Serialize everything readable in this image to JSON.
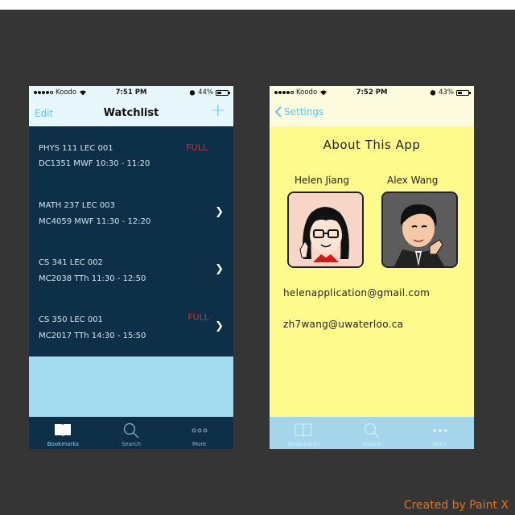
{
  "left_phone": {
    "status": {
      "carrier": "Koodo",
      "time": "7:51 PM",
      "battery": "44%",
      "battery_level": 0.44
    },
    "nav": {
      "edit_label": "Edit",
      "title": "Watchlist",
      "add_label": "+"
    },
    "courses": [
      {
        "line1": "PHYS 111    LEC 001",
        "line2": "DC1351    MWF 10:30 - 11:20",
        "status": "FULL",
        "chevron": false
      },
      {
        "line1": "MATH 237    LEC 003",
        "line2": "MC4059    MWF 11:30 - 12:20",
        "status": "",
        "chevron": true
      },
      {
        "line1": "CS 341    LEC 002",
        "line2": "MC2038    TTh 11:30 - 12:50",
        "status": "",
        "chevron": true
      },
      {
        "line1": "CS 350    LEC 001",
        "line2": "MC2017    TTh 14:30 - 15:50",
        "status": "FULL",
        "chevron": true
      }
    ],
    "tabs": [
      {
        "label": "Bookmarks",
        "icon": "book-icon"
      },
      {
        "label": "Search",
        "icon": "search-icon"
      },
      {
        "label": "More",
        "icon": "more-icon"
      }
    ]
  },
  "right_phone": {
    "status": {
      "carrier": "Koodo",
      "time": "7:52 PM",
      "battery": "43%",
      "battery_level": 0.43
    },
    "nav": {
      "back_label": "Settings"
    },
    "title": "About This App",
    "people": [
      {
        "name": "Helen Jiang"
      },
      {
        "name": "Alex Wang"
      }
    ],
    "emails": [
      "helenapplication@gmail.com",
      "zh7wang@uwaterloo.ca"
    ],
    "tabs": [
      {
        "label": "Bookmarks",
        "icon": "book-icon"
      },
      {
        "label": "Search",
        "icon": "search-icon"
      },
      {
        "label": "More",
        "icon": "more-icon"
      }
    ]
  },
  "credit": "Created by Paint X",
  "colors": {
    "accent": "#5cc6f0",
    "full": "#e3241f",
    "list_bg": "#0d2f47",
    "about_bg": "#fefa8c"
  }
}
